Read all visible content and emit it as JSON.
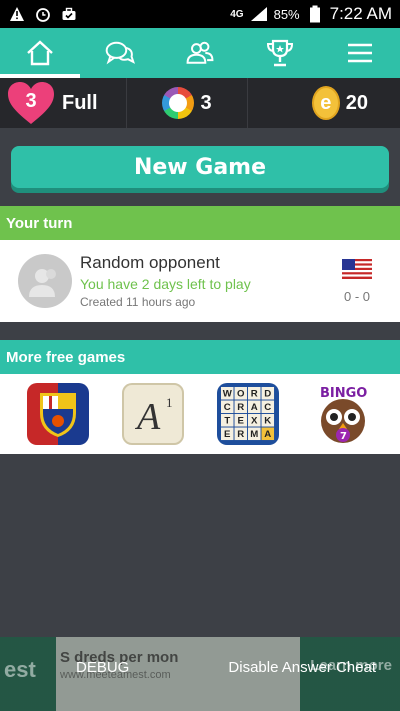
{
  "statusbar": {
    "network": "4G",
    "battery": "85%",
    "time": "7:22 AM"
  },
  "nav": {
    "tabs": [
      "home",
      "chats",
      "friends",
      "rankings",
      "menu"
    ]
  },
  "stats": {
    "lives": "3",
    "lives_label": "Full",
    "spins": "3",
    "coins": "20",
    "coin_symbol": "e"
  },
  "new_game_label": "New Game",
  "your_turn": {
    "title": "Your turn",
    "games": [
      {
        "opponent": "Random opponent",
        "status": "You have 2 days left to play",
        "created": "Created 11 hours ago",
        "score": "0 - 0"
      }
    ]
  },
  "more_games": {
    "title": "More free games",
    "apps": [
      "fc-barcelona-app",
      "apalabrados-app",
      "wordcrack-app",
      "bingo-app"
    ],
    "wordcrack_letters": [
      "W",
      "O",
      "R",
      "D",
      "C",
      "R",
      "A",
      "C",
      "T",
      "E",
      "X",
      "K",
      "E",
      "R",
      "M",
      "A"
    ]
  },
  "ad": {
    "headline": "S  dreds per mon",
    "url": "www.meeteamest.com",
    "logo": "est",
    "cta": "Learn more"
  },
  "debug": {
    "left": "DEBUG",
    "right": "Disable Answer Cheat"
  }
}
